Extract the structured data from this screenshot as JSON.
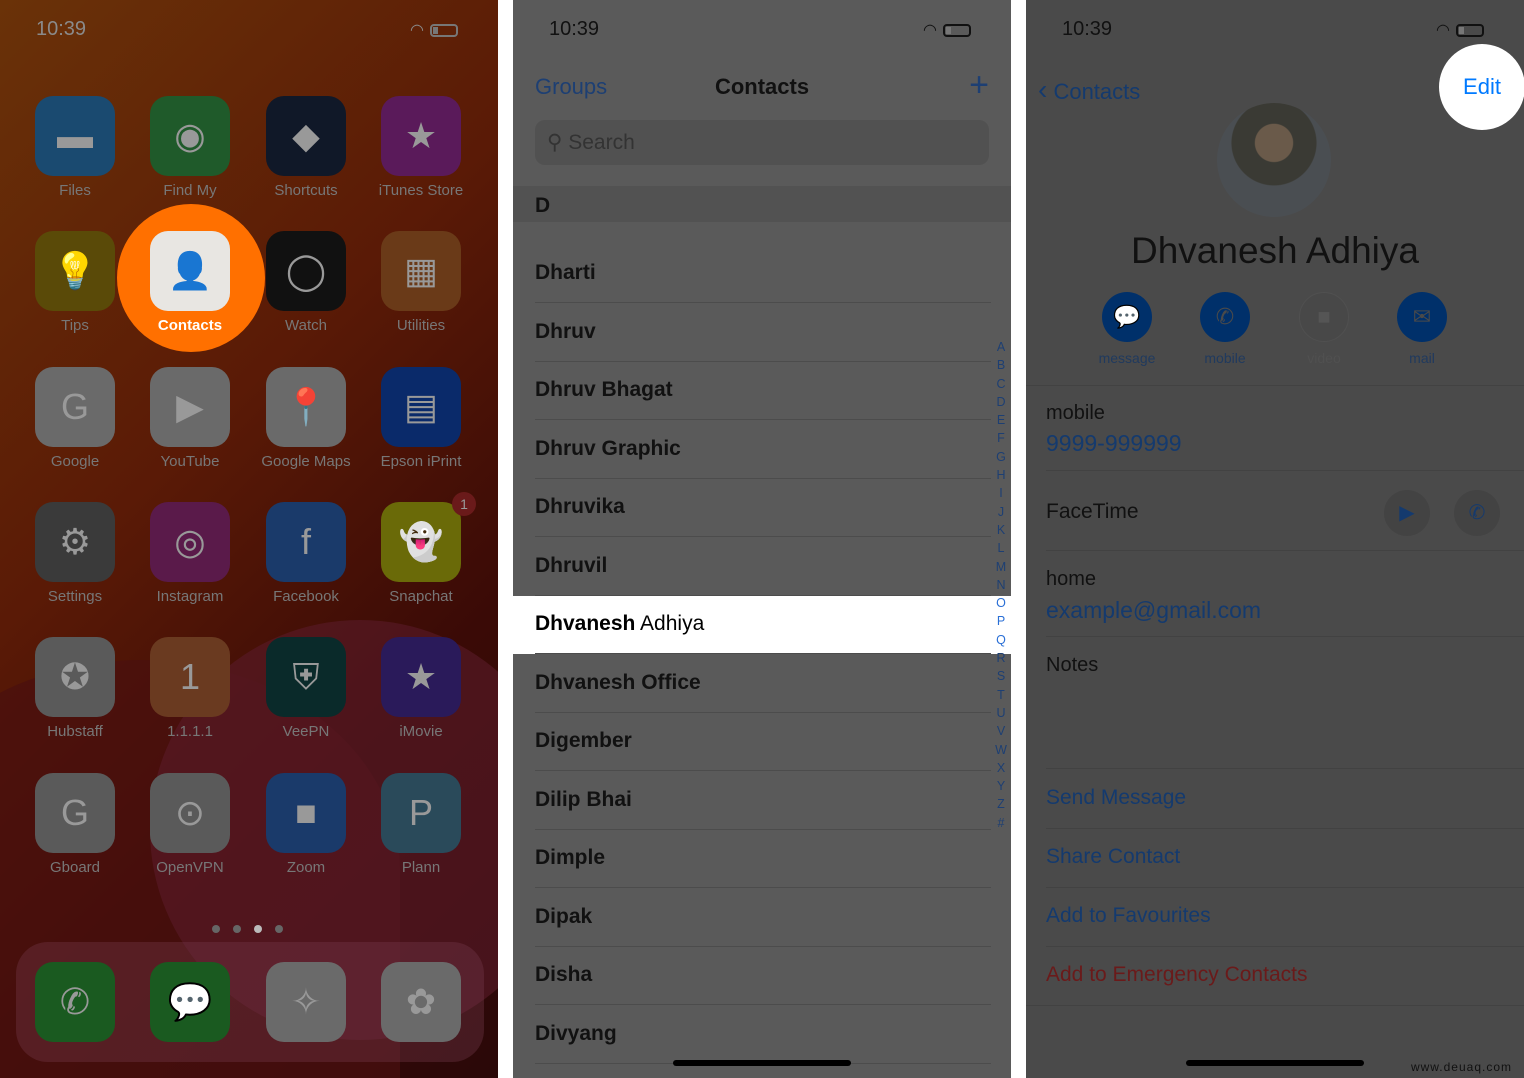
{
  "status": {
    "time": "10:39"
  },
  "home": {
    "apps": [
      {
        "label": "Files",
        "icon": "folder-icon",
        "color": "#1a4a70"
      },
      {
        "label": "Find My",
        "icon": "find-my-icon",
        "color": "#1f5a2a"
      },
      {
        "label": "Shortcuts",
        "icon": "shortcuts-icon",
        "color": "#101828"
      },
      {
        "label": "iTunes Store",
        "icon": "star-icon",
        "color": "#5a1a5a"
      },
      {
        "label": "Tips",
        "icon": "lightbulb-icon",
        "color": "#5a4a08"
      },
      {
        "label": "Contacts",
        "icon": "contacts-icon",
        "color": "#e8e6e2"
      },
      {
        "label": "Watch",
        "icon": "watch-icon",
        "color": "#111111"
      },
      {
        "label": "Utilities",
        "icon": "folder-grid-icon",
        "color": "#6a3a18"
      },
      {
        "label": "Google",
        "icon": "google-icon",
        "color": "#6a6a6a"
      },
      {
        "label": "YouTube",
        "icon": "youtube-icon",
        "color": "#6a6a6a"
      },
      {
        "label": "Google Maps",
        "icon": "maps-pin-icon",
        "color": "#6a6a6a"
      },
      {
        "label": "Epson iPrint",
        "icon": "printer-icon",
        "color": "#0a2a6a"
      },
      {
        "label": "Settings",
        "icon": "gear-icon",
        "color": "#3a3a3a"
      },
      {
        "label": "Instagram",
        "icon": "camera-icon",
        "color": "#5a1a4a"
      },
      {
        "label": "Facebook",
        "icon": "facebook-icon",
        "color": "#1a3a6a"
      },
      {
        "label": "Snapchat",
        "icon": "ghost-icon",
        "color": "#6a6a08"
      },
      {
        "label": "Hubstaff",
        "icon": "hubstaff-icon",
        "color": "#5a5a5a"
      },
      {
        "label": "1.1.1.1",
        "icon": "one-icon",
        "color": "#6a3a20"
      },
      {
        "label": "VeePN",
        "icon": "shield-icon",
        "color": "#0a2a2a"
      },
      {
        "label": "iMovie",
        "icon": "star-camera-icon",
        "color": "#2a1a5a"
      },
      {
        "label": "Gboard",
        "icon": "gboard-icon",
        "color": "#5a5a5a"
      },
      {
        "label": "OpenVPN",
        "icon": "keyhole-icon",
        "color": "#5a5a5a"
      },
      {
        "label": "Zoom",
        "icon": "video-icon",
        "color": "#1a3a6a"
      },
      {
        "label": "Plann",
        "icon": "plann-icon",
        "color": "#2a4a5a"
      }
    ],
    "epson_text": "EPSON",
    "plann_text": "PLANN",
    "snapchat_badge": "1",
    "page_count": 4,
    "current_page": 3,
    "dock": [
      {
        "icon": "phone-icon",
        "color": "#1a5a20"
      },
      {
        "icon": "messages-icon",
        "color": "#1a5a20"
      },
      {
        "icon": "safari-icon",
        "color": "#6a6a6a"
      },
      {
        "icon": "photos-icon",
        "color": "#6a6a6a"
      }
    ]
  },
  "contacts": {
    "groups": "Groups",
    "title": "Contacts",
    "add": "+",
    "search_placeholder": "Search",
    "section": "D",
    "rows": [
      {
        "bold": "Dharti",
        "rest": ""
      },
      {
        "bold": "Dhruv",
        "rest": ""
      },
      {
        "bold": "Dhruv Bhagat",
        "rest": ""
      },
      {
        "bold": "Dhruv Graphic",
        "rest": ""
      },
      {
        "bold": "Dhruvika",
        "rest": ""
      },
      {
        "bold": "Dhruvil",
        "rest": ""
      },
      {
        "bold": "Dhvanesh",
        "rest": " Adhiya",
        "selected": true
      },
      {
        "bold": "Dhvanesh Office",
        "rest": ""
      },
      {
        "bold": "Digember",
        "rest": ""
      },
      {
        "bold": "Dilip Bhai",
        "rest": ""
      },
      {
        "bold": "Dimple",
        "rest": ""
      },
      {
        "bold": "Dipak",
        "rest": ""
      },
      {
        "bold": "Disha",
        "rest": ""
      },
      {
        "bold": "Divyang",
        "rest": ""
      }
    ],
    "index": [
      "A",
      "B",
      "C",
      "D",
      "E",
      "F",
      "G",
      "H",
      "I",
      "J",
      "K",
      "L",
      "M",
      "N",
      "O",
      "P",
      "Q",
      "R",
      "S",
      "T",
      "U",
      "V",
      "W",
      "X",
      "Y",
      "Z",
      "#"
    ]
  },
  "detail": {
    "back": "Contacts",
    "edit": "Edit",
    "name": "Dhvanesh Adhiya",
    "actions": [
      {
        "label": "message",
        "icon": "message-icon"
      },
      {
        "label": "mobile",
        "icon": "phone-icon"
      },
      {
        "label": "video",
        "icon": "video-icon",
        "disabled": true
      },
      {
        "label": "mail",
        "icon": "mail-icon"
      }
    ],
    "mobile_label": "mobile",
    "mobile_value": "9999-999999",
    "facetime_label": "FaceTime",
    "home_label": "home",
    "home_value": "example@gmail.com",
    "notes_label": "Notes",
    "links": [
      "Send Message",
      "Share Contact",
      "Add to Favourites"
    ],
    "emergency": "Add to Emergency Contacts",
    "accent": "#007aff",
    "highlight": "#ff7000"
  },
  "watermark": "www.deuaq.com"
}
